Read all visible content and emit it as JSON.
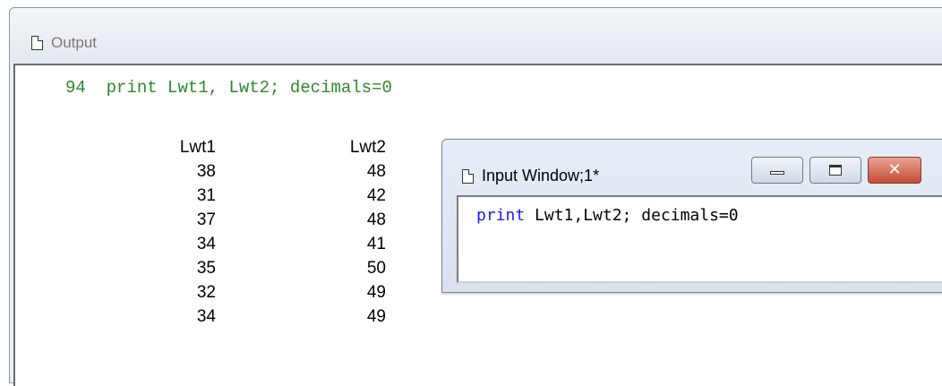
{
  "output_window": {
    "title": "Output",
    "command_line": {
      "number": "94",
      "text": "print Lwt1, Lwt2; decimals=0"
    },
    "table": {
      "headers": [
        "Lwt1",
        "Lwt2"
      ],
      "rows": [
        [
          "38",
          "48"
        ],
        [
          "31",
          "42"
        ],
        [
          "37",
          "48"
        ],
        [
          "34",
          "41"
        ],
        [
          "35",
          "50"
        ],
        [
          "32",
          "49"
        ],
        [
          "34",
          "49"
        ]
      ]
    }
  },
  "input_window": {
    "title": "Input Window;1*",
    "code_keyword": "print",
    "code_rest": " Lwt1,Lwt2; decimals=0"
  },
  "icons": {
    "document": "document-icon",
    "minimize": "minimize-icon",
    "maximize": "maximize-icon",
    "close": "close-icon"
  },
  "colors": {
    "command_text": "#2a8a2a",
    "keyword": "#1a1aff",
    "close_button": "#c44d33"
  }
}
